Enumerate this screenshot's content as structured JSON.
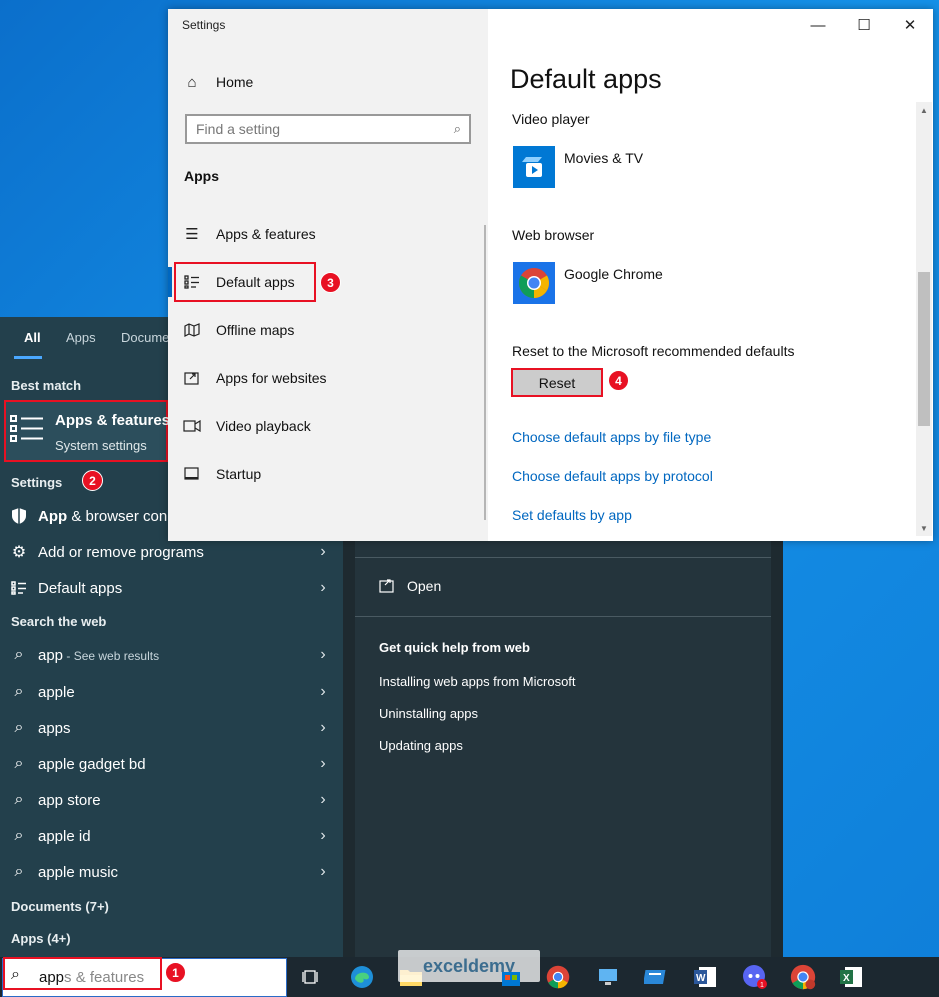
{
  "settings_window": {
    "title": "Settings",
    "controls": {
      "minimize": "—",
      "maximize": "☐",
      "close": "✕"
    },
    "nav": {
      "home": "Home",
      "search_placeholder": "Find a setting",
      "section": "Apps",
      "items": [
        {
          "label": "Apps & features",
          "icon": "list-icon"
        },
        {
          "label": "Default apps",
          "icon": "default-apps-icon"
        },
        {
          "label": "Offline maps",
          "icon": "map-icon"
        },
        {
          "label": "Apps for websites",
          "icon": "link-icon"
        },
        {
          "label": "Video playback",
          "icon": "video-icon"
        },
        {
          "label": "Startup",
          "icon": "startup-icon"
        }
      ]
    },
    "main": {
      "title": "Default apps",
      "video_player_label": "Video player",
      "video_player_app": "Movies & TV",
      "web_browser_label": "Web browser",
      "web_browser_app": "Google Chrome",
      "reset_label": "Reset to the Microsoft recommended defaults",
      "reset_button": "Reset",
      "links": [
        "Choose default apps by file type",
        "Choose default apps by protocol",
        "Set defaults by app"
      ]
    }
  },
  "start_menu": {
    "tabs": [
      "All",
      "Apps",
      "Docume"
    ],
    "best_match_heading": "Best match",
    "best_match": {
      "title": "Apps & features",
      "subtitle": "System settings"
    },
    "settings_heading": "Settings",
    "settings_items": [
      {
        "label_bold": "App",
        "label_rest": " & browser con",
        "icon": "shield-icon"
      },
      {
        "label_bold": "",
        "label_rest": "Add or remove programs",
        "icon": "gear-icon"
      },
      {
        "label_bold": "",
        "label_rest": "Default apps",
        "icon": "default-apps-icon"
      }
    ],
    "web_heading": "Search the web",
    "web_items": [
      {
        "bold": "app",
        "rest": " - See web results"
      },
      {
        "bold": "apple",
        "rest": ""
      },
      {
        "bold": "apps",
        "rest": ""
      },
      {
        "bold": "apple gadget bd",
        "rest": ""
      },
      {
        "bold": "app store",
        "rest": ""
      },
      {
        "bold": "apple id",
        "rest": ""
      },
      {
        "bold": "apple music",
        "rest": ""
      }
    ],
    "documents_heading": "Documents (7+)",
    "apps_heading": "Apps (4+)",
    "right_pane": {
      "open": "Open",
      "help_heading": "Get quick help from web",
      "help_items": [
        "Installing web apps from Microsoft",
        "Uninstalling apps",
        "Updating apps"
      ]
    }
  },
  "taskbar": {
    "search_typed": "app",
    "search_completion": "s & features",
    "watermark": "exceldemy",
    "icons": [
      "task-view-icon",
      "edge-icon",
      "file-explorer-icon",
      "store-icon",
      "chrome-icon",
      "desktop-icon",
      "app-icon",
      "word-icon",
      "discord-icon",
      "chrome-profile-icon",
      "excel-icon"
    ]
  },
  "annotations": [
    "1",
    "2",
    "3",
    "4"
  ],
  "colors": {
    "accent": "#e81123",
    "link": "#0067c0",
    "start_bg": "#23404c",
    "taskbar_bg": "#1c2830"
  }
}
